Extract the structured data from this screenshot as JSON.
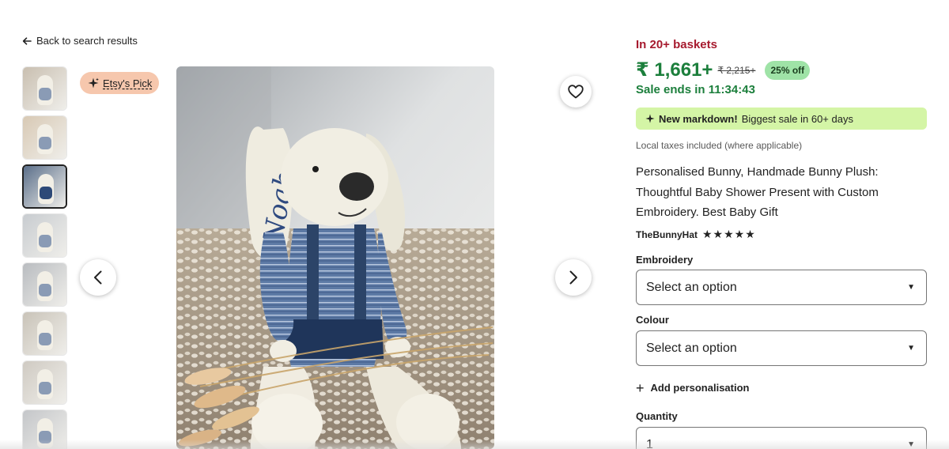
{
  "nav": {
    "back_label": "Back to search results"
  },
  "badge": {
    "label": "Etsy's Pick"
  },
  "gallery": {
    "thumbnail_count": 8,
    "active_index": 2,
    "thumb_colors": [
      "#c9bfb0",
      "#d8c9b4",
      "#5b6f8a",
      "#c8ccd0",
      "#b9bcc0",
      "#c9c3b8",
      "#cfcac2",
      "#c4c6c9"
    ]
  },
  "product": {
    "baskets": "In 20+ baskets",
    "price": "₹ 1,661+",
    "old_price": "₹ 2,215+",
    "discount": "25% off",
    "sale_ends": "Sale ends in 11:34:43",
    "markdown_bold": "New markdown!",
    "markdown_text": "Biggest sale in 60+ days",
    "taxes": "Local taxes included (where applicable)",
    "title": "Personalised Bunny, Handmade Bunny Plush: Thoughtful Baby Shower Present with Custom Embroidery. Best Baby Gift",
    "shop_name": "TheBunnyHat",
    "rating": 5,
    "rating_stars": "★★★★★"
  },
  "embroidery": {
    "label": "Embroidery",
    "value": "Select an option"
  },
  "colour": {
    "label": "Colour",
    "value": "Select an option"
  },
  "personalisation": {
    "label": "Add personalisation"
  },
  "quantity": {
    "label": "Quantity",
    "value": "1"
  },
  "image": {
    "embroidered_name": "Noah"
  },
  "colors": {
    "price_green": "#1c7f3c",
    "basket_red": "#a61a2e",
    "markdown_bg": "#d4f5a6",
    "badge_bg": "#f6c7ad",
    "off_bg": "#9fe3a7"
  }
}
